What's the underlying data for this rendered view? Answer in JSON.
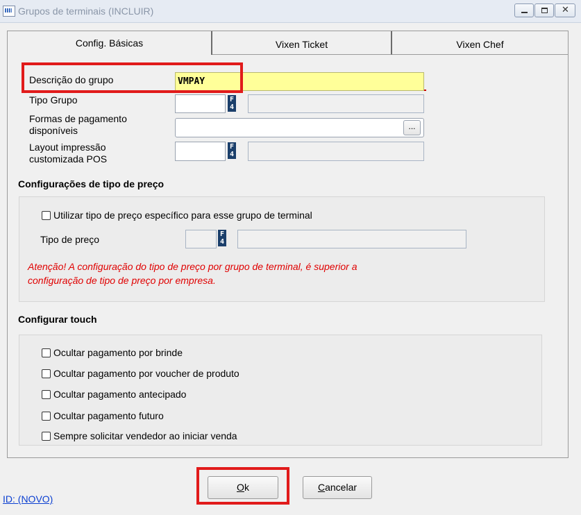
{
  "window": {
    "title": "Grupos de terminais (INCLUIR)"
  },
  "tabs": [
    {
      "label": "Config. Básicas",
      "active": true
    },
    {
      "label": "Vixen Ticket",
      "active": false
    },
    {
      "label": "Vixen Chef",
      "active": false
    }
  ],
  "form": {
    "descricao_label": "Descrição do grupo",
    "descricao_value": "VMPAY",
    "tipo_grupo_label": "Tipo Grupo",
    "formas_label_1": "Formas de pagamento",
    "formas_label_2": "disponíveis",
    "browse_label": "...",
    "layout_label_1": "Layout impressão",
    "layout_label_2": "customizada POS",
    "f4_label": "F4"
  },
  "price_config": {
    "section_title": "Configurações de tipo de preço",
    "checkbox_label": "Utilizar tipo de preço específico para esse grupo de terminal",
    "checked": false,
    "tipo_preco_label": "Tipo de preço",
    "warning_line1": "Atenção! A configuração do tipo de preço por grupo de terminal, é superior a",
    "warning_line2": "configuração de tipo de preço por empresa."
  },
  "touch": {
    "section_title": "Configurar touch",
    "options": [
      {
        "label": "Ocultar pagamento por brinde",
        "checked": false
      },
      {
        "label": "Ocultar pagamento por voucher de produto",
        "checked": false
      },
      {
        "label": "Ocultar pagamento antecipado",
        "checked": false
      },
      {
        "label": "Ocultar pagamento futuro",
        "checked": false
      },
      {
        "label": "Sempre solicitar vendedor ao iniciar venda",
        "checked": false
      }
    ]
  },
  "footer": {
    "id_link": "ID: (NOVO)",
    "ok_rest": "k",
    "ok_accel": "O",
    "cancel_rest": "ancelar",
    "cancel_accel": "C"
  },
  "colors": {
    "highlight_red": "#e11b1b",
    "warning_text": "#e00000",
    "input_yellow": "#ffff99",
    "f4_button": "#1b3f6b",
    "link_blue": "#0b3fd1"
  }
}
